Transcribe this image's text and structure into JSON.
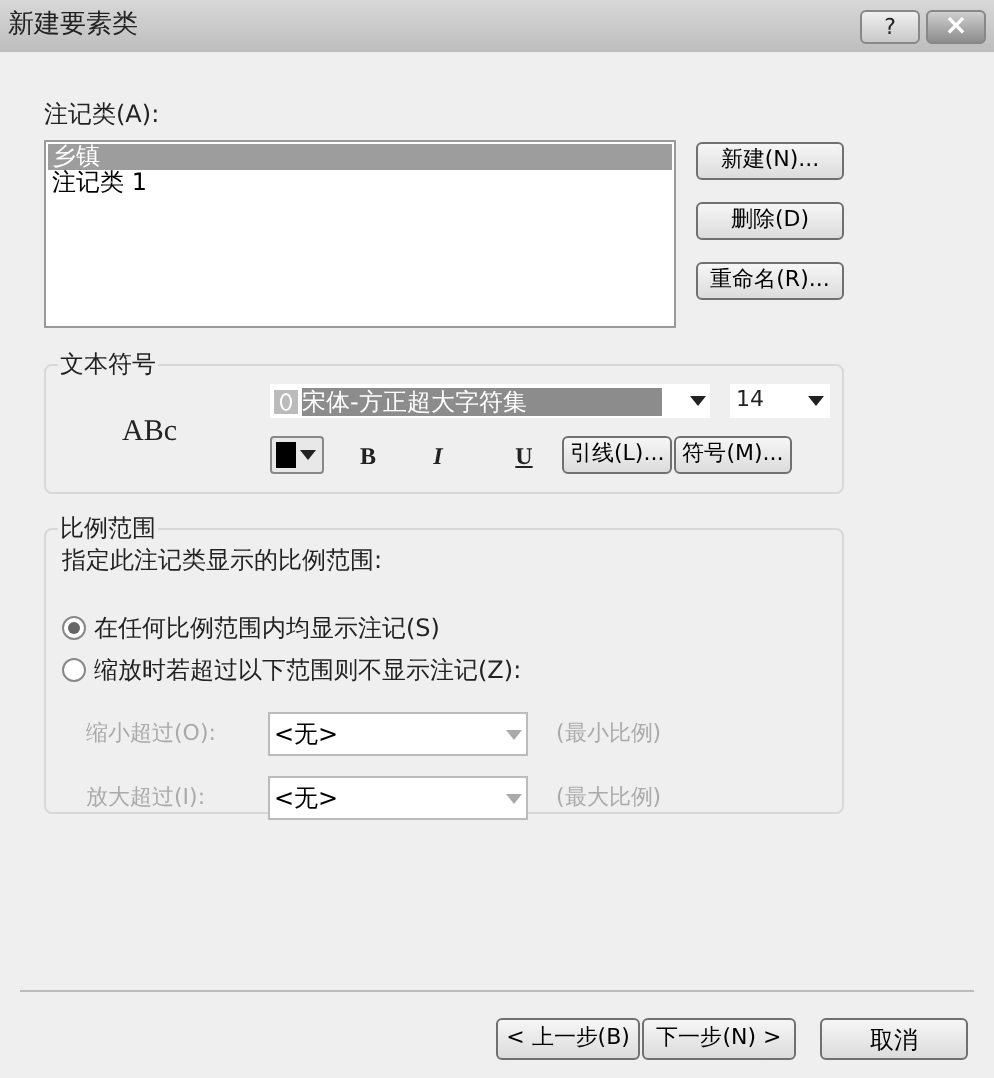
{
  "window": {
    "title": "新建要素类",
    "help": "?",
    "close": "×"
  },
  "annotation_classes": {
    "label": "注记类(A):",
    "items": [
      {
        "text": "乡镇",
        "selected": true
      },
      {
        "text": "注记类 1",
        "selected": false
      }
    ],
    "buttons": [
      {
        "label": "新建(N)..."
      },
      {
        "label": "删除(D)"
      },
      {
        "label": "重命名(R)..."
      }
    ]
  },
  "text_symbol": {
    "legend": "文本符号",
    "preview": "ABc",
    "font": "宋体-方正超大字符集",
    "size": "14",
    "bold": "B",
    "italic": "I",
    "underline": "U",
    "buttons": [
      {
        "label": "引线(L)..."
      },
      {
        "label": "符号(M)..."
      }
    ]
  },
  "scale_range": {
    "legend": "比例范围",
    "description": "指定此注记类显示的比例范围:",
    "options": [
      {
        "label": "在任何比例范围内均显示注记(S)",
        "selected": true
      },
      {
        "label": "缩放时若超过以下范围则不显示注记(Z):",
        "selected": false
      }
    ],
    "limits": [
      {
        "label": "缩小超过(O):",
        "value": "<无>",
        "hint": "(最小比例)",
        "disabled": true
      },
      {
        "label": "放大超过(I):",
        "value": "<无>",
        "hint": "(最大比例)",
        "disabled": true
      }
    ]
  },
  "footer": {
    "back": "< 上一步(B)",
    "next": "下一步(N) >",
    "cancel": "取消"
  }
}
